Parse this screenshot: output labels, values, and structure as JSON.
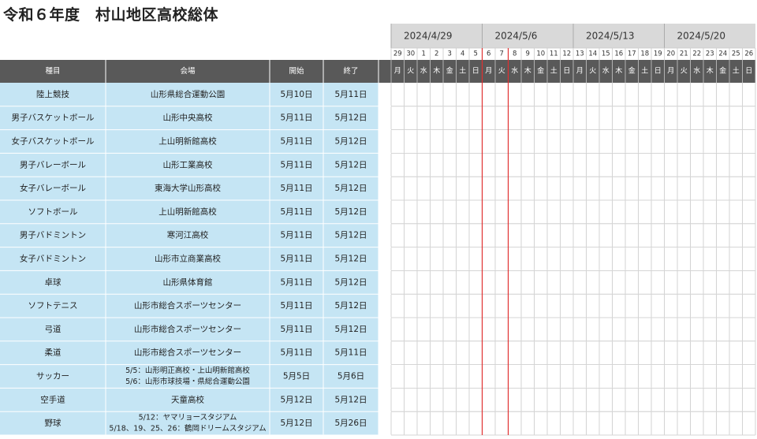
{
  "title": "令和６年度　村山地区高校総体",
  "colors": {
    "header_bg": "#595959",
    "left_bg": "#c5e5f4",
    "week_bg": "#d9d9d9",
    "bar": "#0e9ed6",
    "today_line": "#e03030",
    "grid": "#c8c8c8"
  },
  "columns": {
    "event": "種目",
    "venue": "会場",
    "start": "開始",
    "end": "終了"
  },
  "weeks": [
    "2024/4/29",
    "2024/5/6",
    "2024/5/13",
    "2024/5/20"
  ],
  "day_numbers": [
    "29",
    "30",
    "1",
    "2",
    "3",
    "4",
    "5",
    "6",
    "7",
    "8",
    "9",
    "10",
    "11",
    "12",
    "13",
    "14",
    "15",
    "16",
    "17",
    "18",
    "19",
    "20",
    "21",
    "22",
    "23",
    "24",
    "25",
    "26"
  ],
  "weekdays": [
    "月",
    "火",
    "水",
    "木",
    "金",
    "土",
    "日",
    "月",
    "火",
    "水",
    "木",
    "金",
    "土",
    "日",
    "月",
    "火",
    "水",
    "木",
    "金",
    "土",
    "日",
    "月",
    "火",
    "水",
    "木",
    "金",
    "土",
    "日"
  ],
  "marker_days": [
    7,
    9
  ],
  "chart_data": {
    "type": "gantt",
    "x_start": "2024/4/29",
    "tasks": [
      {
        "event": "陸上競技",
        "venue": [
          "山形県総合運動公園"
        ],
        "start_label": "5月10日",
        "end_label": "5月11日",
        "start": "2024/5/10",
        "end": "2024/5/11"
      },
      {
        "event": "男子バスケットボール",
        "venue": [
          "山形中央高校"
        ],
        "start_label": "5月11日",
        "end_label": "5月12日",
        "start": "2024/5/11",
        "end": "2024/5/12"
      },
      {
        "event": "女子バスケットボール",
        "venue": [
          "上山明新館高校"
        ],
        "start_label": "5月11日",
        "end_label": "5月12日",
        "start": "2024/5/11",
        "end": "2024/5/12"
      },
      {
        "event": "男子バレーボール",
        "venue": [
          "山形工業高校"
        ],
        "start_label": "5月11日",
        "end_label": "5月12日",
        "start": "2024/5/11",
        "end": "2024/5/12"
      },
      {
        "event": "女子バレーボール",
        "venue": [
          "東海大学山形高校"
        ],
        "start_label": "5月11日",
        "end_label": "5月12日",
        "start": "2024/5/11",
        "end": "2024/5/12"
      },
      {
        "event": "ソフトボール",
        "venue": [
          "上山明新館高校"
        ],
        "start_label": "5月11日",
        "end_label": "5月12日",
        "start": "2024/5/11",
        "end": "2024/5/12"
      },
      {
        "event": "男子バドミントン",
        "venue": [
          "寒河江高校"
        ],
        "start_label": "5月11日",
        "end_label": "5月12日",
        "start": "2024/5/11",
        "end": "2024/5/12"
      },
      {
        "event": "女子バドミントン",
        "venue": [
          "山形市立商業高校"
        ],
        "start_label": "5月11日",
        "end_label": "5月12日",
        "start": "2024/5/11",
        "end": "2024/5/12"
      },
      {
        "event": "卓球",
        "venue": [
          "山形県体育館"
        ],
        "start_label": "5月11日",
        "end_label": "5月12日",
        "start": "2024/5/11",
        "end": "2024/5/12"
      },
      {
        "event": "ソフトテニス",
        "venue": [
          "山形市総合スポーツセンター"
        ],
        "start_label": "5月11日",
        "end_label": "5月12日",
        "start": "2024/5/11",
        "end": "2024/5/12"
      },
      {
        "event": "弓道",
        "venue": [
          "山形市総合スポーツセンター"
        ],
        "start_label": "5月11日",
        "end_label": "5月12日",
        "start": "2024/5/11",
        "end": "2024/5/12"
      },
      {
        "event": "柔道",
        "venue": [
          "山形市総合スポーツセンター"
        ],
        "start_label": "5月11日",
        "end_label": "5月11日",
        "start": "2024/5/11",
        "end": "2024/5/11"
      },
      {
        "event": "サッカー",
        "venue": [
          "5/5：山形明正高校・上山明新館高校",
          "5/6：山形市球技場・県総合運動公園"
        ],
        "start_label": "5月5日",
        "end_label": "5月6日",
        "start": "2024/5/5",
        "end": "2024/5/6"
      },
      {
        "event": "空手道",
        "venue": [
          "天童高校"
        ],
        "start_label": "5月12日",
        "end_label": "5月12日",
        "start": "2024/5/12",
        "end": "2024/5/12"
      },
      {
        "event": "野球",
        "venue": [
          "5/12：ヤマリョースタジアム",
          "5/18、19、25、26：鶴岡ドリームスタジアム"
        ],
        "start_label": "5月12日",
        "end_label": "5月26日",
        "start": "2024/5/12",
        "end": "2024/5/26"
      }
    ]
  }
}
